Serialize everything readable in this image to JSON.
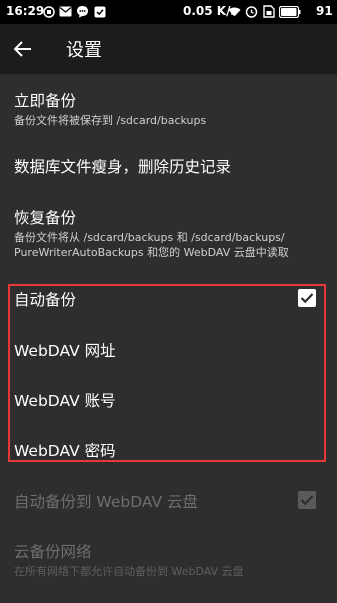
{
  "status_bar": {
    "time": "16:29",
    "speed": "0.05 K/s",
    "battery": "91"
  },
  "toolbar": {
    "title": "设置"
  },
  "items": [
    {
      "title": "立即备份",
      "summary": "备份文件将被保存到 /sdcard/backups"
    },
    {
      "title": "数据库文件瘦身，删除历史记录"
    },
    {
      "title": "恢复备份",
      "summary": "备份文件将从 /sdcard/backups 和 /sdcard/backups/ PureWriterAutoBackups 和您的 WebDAV 云盘中读取"
    },
    {
      "title": "自动备份",
      "checked": true
    },
    {
      "title": "WebDAV 网址"
    },
    {
      "title": "WebDAV 账号"
    },
    {
      "title": "WebDAV 密码"
    },
    {
      "title": "自动备份到 WebDAV 云盘",
      "checked": true,
      "enabled": false
    },
    {
      "title": "云备份网络",
      "summary": "在所有网络下都允许自动备份到 WebDAV 云盘",
      "enabled": false
    }
  ],
  "colors": {
    "background": "#2e2e2e",
    "toolbar": "#1c1c1c",
    "highlight": "#e53935"
  }
}
